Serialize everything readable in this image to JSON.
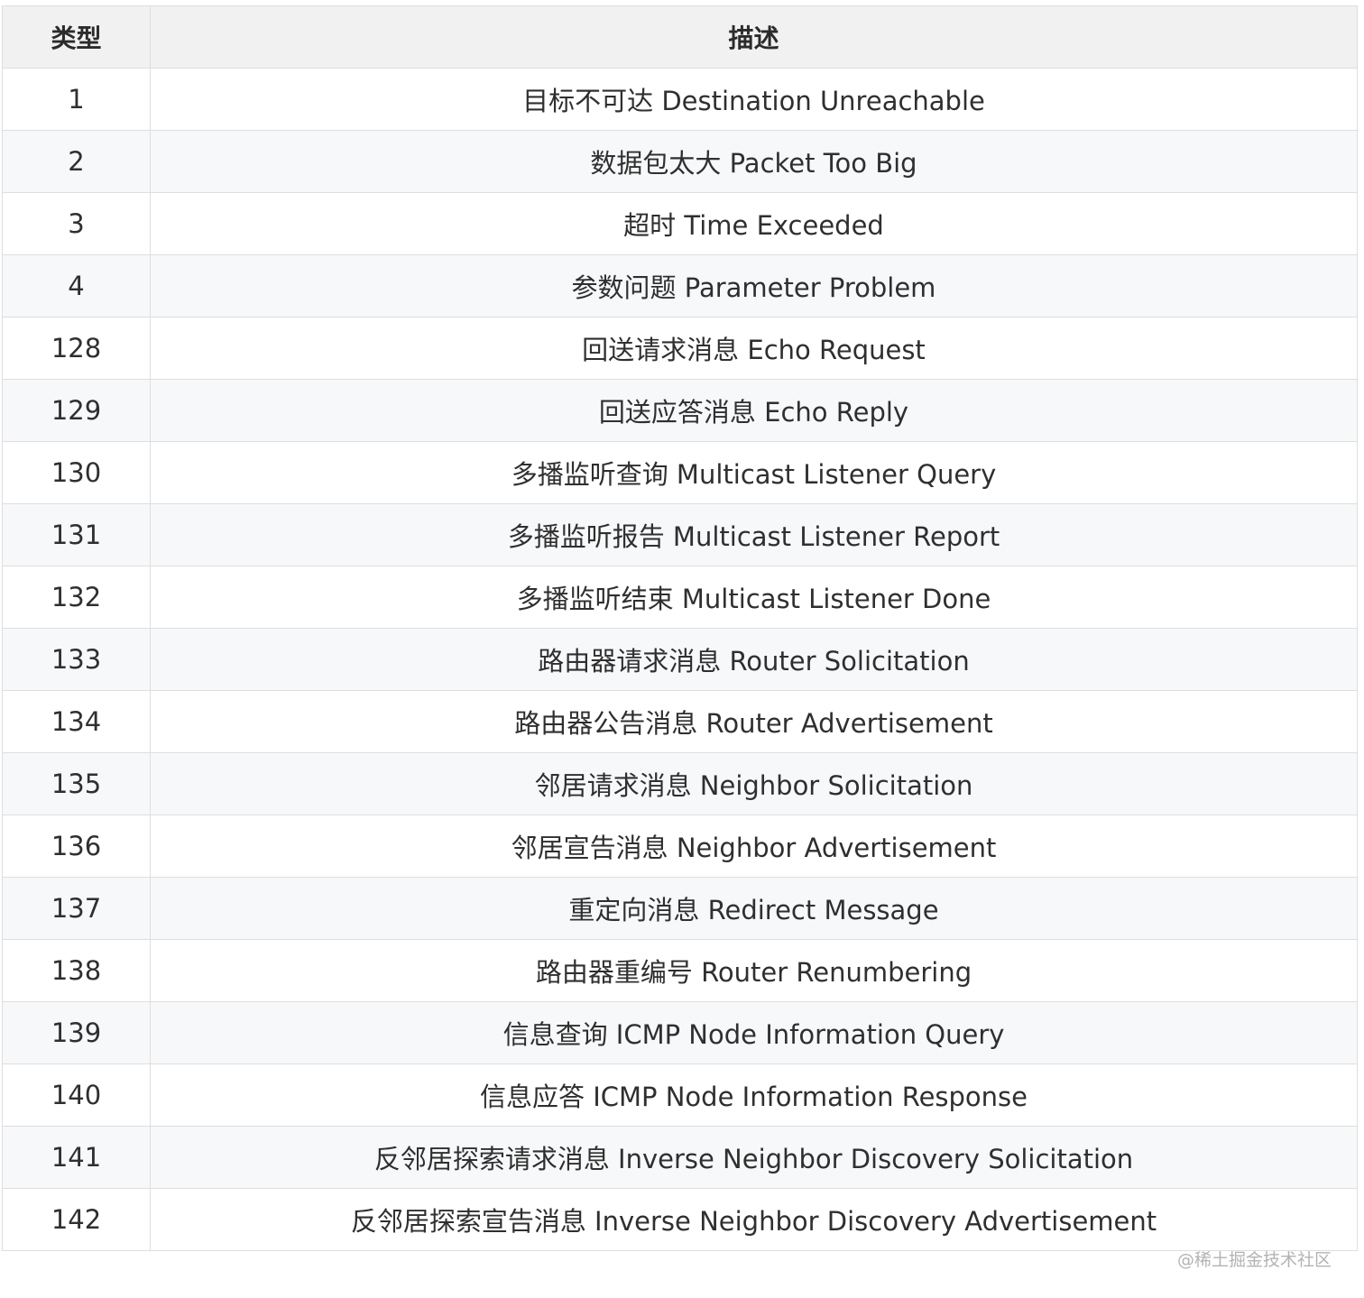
{
  "table": {
    "headers": [
      "类型",
      "描述"
    ],
    "rows": [
      {
        "type": "1",
        "desc": "目标不可达 Destination Unreachable"
      },
      {
        "type": "2",
        "desc": "数据包太大 Packet Too Big"
      },
      {
        "type": "3",
        "desc": "超时 Time Exceeded"
      },
      {
        "type": "4",
        "desc": "参数问题 Parameter Problem"
      },
      {
        "type": "128",
        "desc": "回送请求消息 Echo Request"
      },
      {
        "type": "129",
        "desc": "回送应答消息 Echo Reply"
      },
      {
        "type": "130",
        "desc": "多播监听查询 Multicast Listener Query"
      },
      {
        "type": "131",
        "desc": "多播监听报告 Multicast Listener Report"
      },
      {
        "type": "132",
        "desc": "多播监听结束 Multicast Listener Done"
      },
      {
        "type": "133",
        "desc": "路由器请求消息 Router Solicitation"
      },
      {
        "type": "134",
        "desc": "路由器公告消息 Router Advertisement"
      },
      {
        "type": "135",
        "desc": "邻居请求消息 Neighbor Solicitation"
      },
      {
        "type": "136",
        "desc": "邻居宣告消息 Neighbor Advertisement"
      },
      {
        "type": "137",
        "desc": "重定向消息 Redirect Message"
      },
      {
        "type": "138",
        "desc": "路由器重编号 Router Renumbering"
      },
      {
        "type": "139",
        "desc": "信息查询 ICMP Node Information Query"
      },
      {
        "type": "140",
        "desc": "信息应答 ICMP Node Information Response"
      },
      {
        "type": "141",
        "desc": "反邻居探索请求消息 Inverse Neighbor Discovery Solicitation"
      },
      {
        "type": "142",
        "desc": "反邻居探索宣告消息 Inverse Neighbor Discovery Advertisement"
      }
    ]
  },
  "watermark": "@稀土掘金技术社区"
}
